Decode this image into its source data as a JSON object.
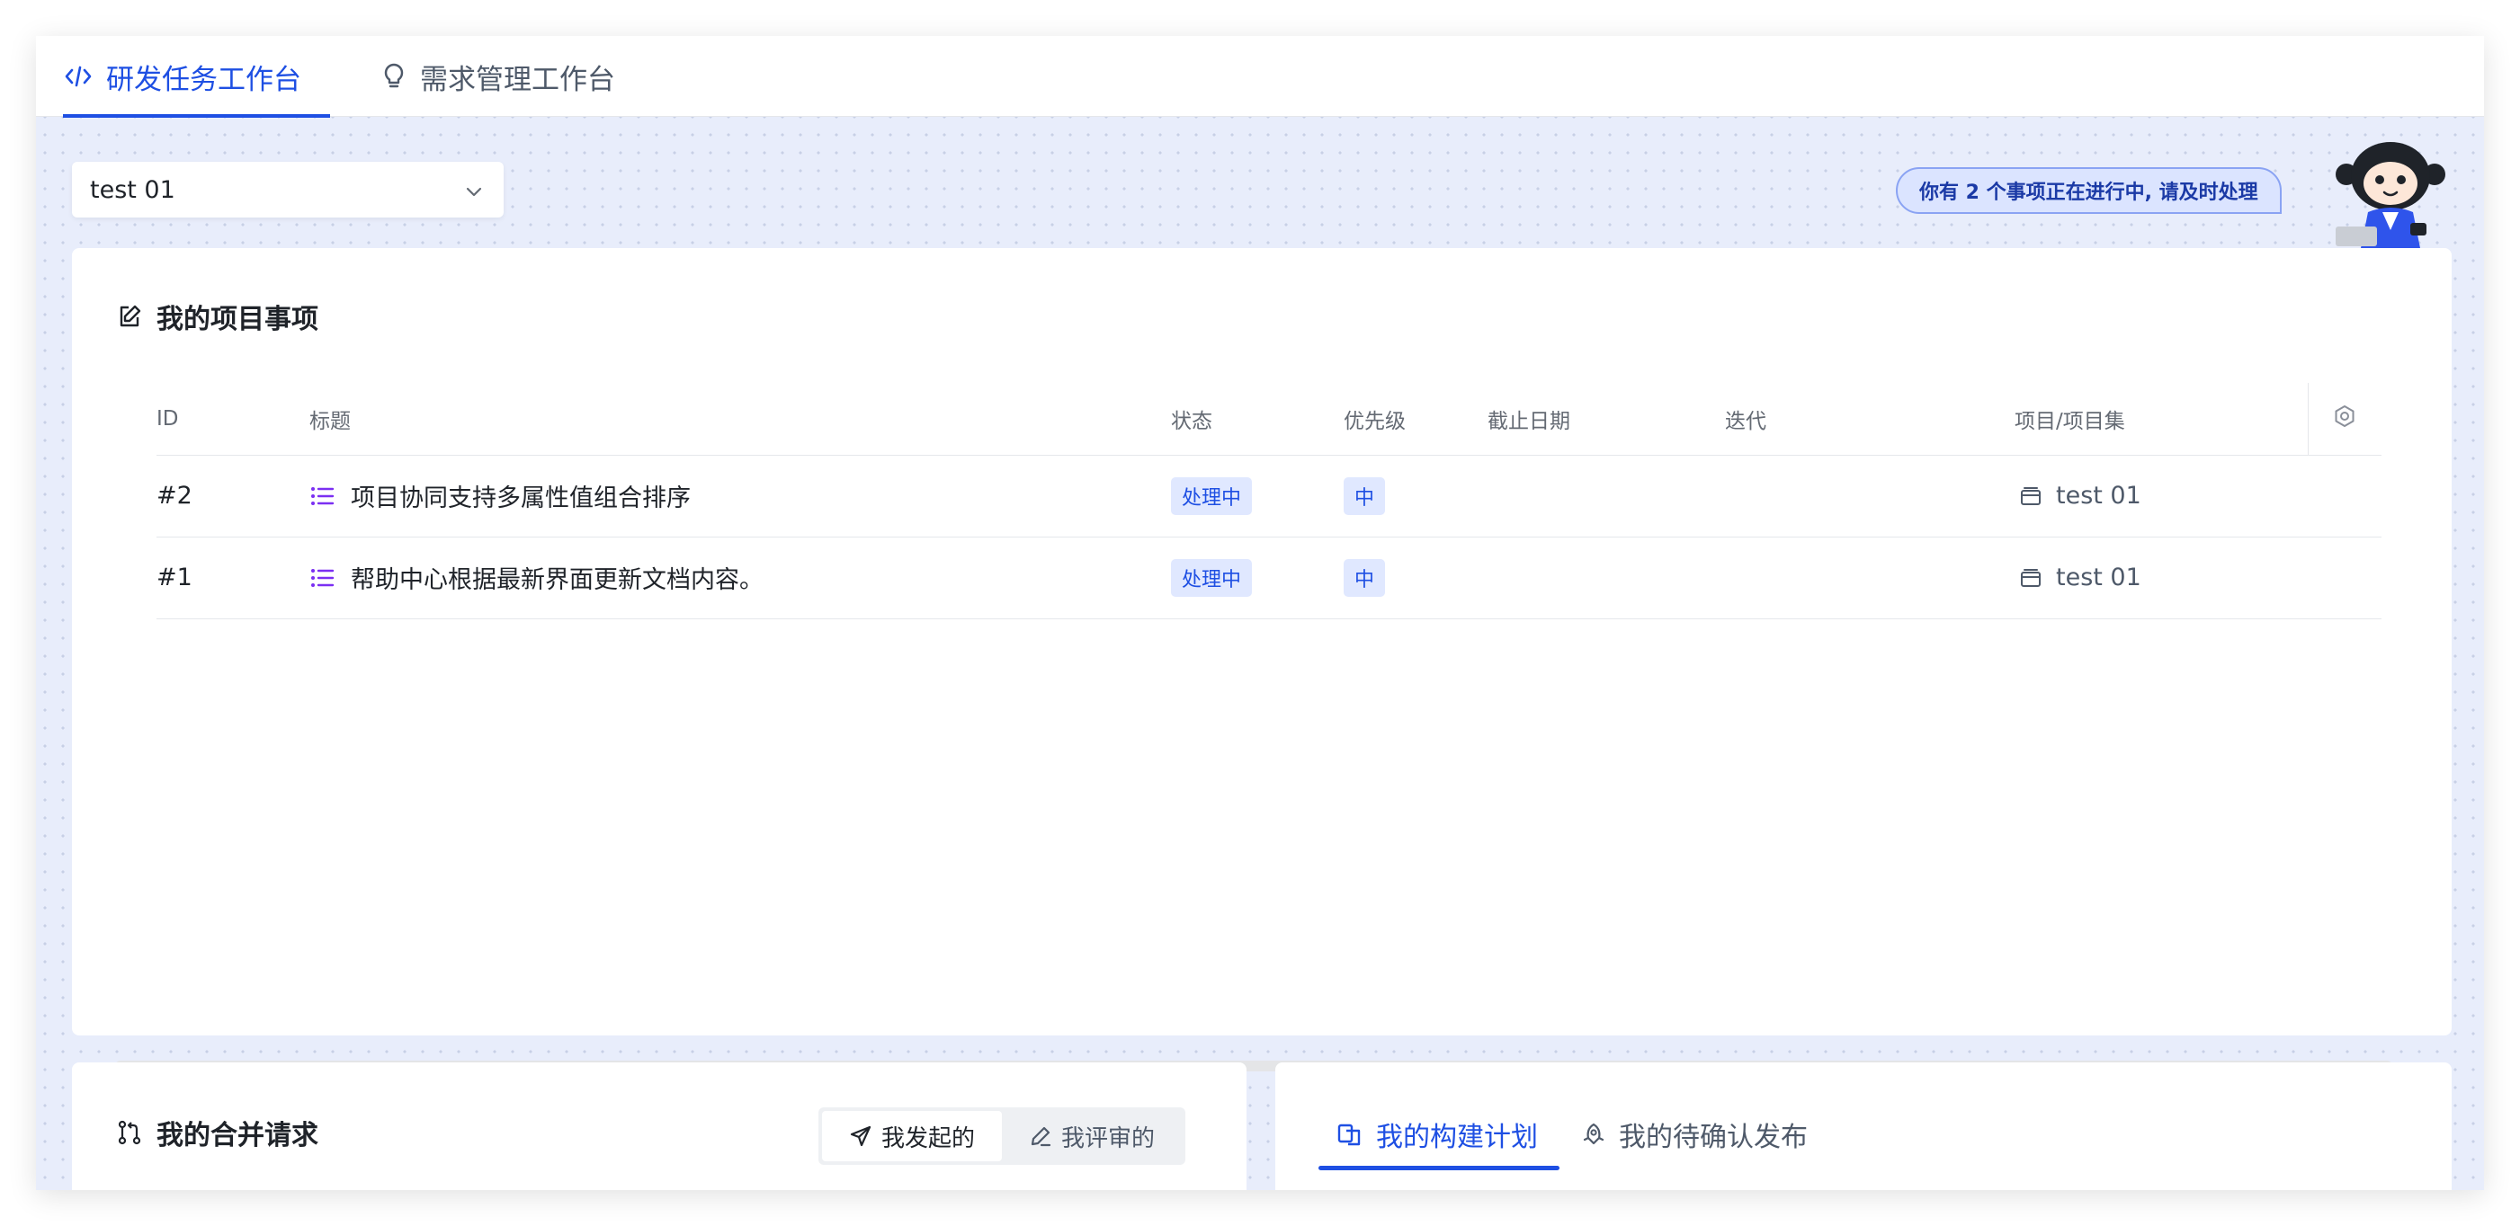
{
  "top_tabs": [
    {
      "label": "研发任务工作台",
      "icon": "code-icon",
      "active": true
    },
    {
      "label": "需求管理工作台",
      "icon": "lightbulb-icon",
      "active": false
    }
  ],
  "project_select": {
    "value": "test 01",
    "icon": "chevron-down-icon"
  },
  "notice": "你有 2 个事项正在进行中, 请及时处理",
  "items_card": {
    "title": "我的项目事项",
    "icon": "edit-note-icon",
    "columns": [
      "ID",
      "标题",
      "状态",
      "优先级",
      "截止日期",
      "迭代",
      "项目/项目集"
    ],
    "rows": [
      {
        "id": "#2",
        "title": "项目协同支持多属性值组合排序",
        "status": "处理中",
        "priority": "中",
        "due": "",
        "iteration": "",
        "project": "test 01"
      },
      {
        "id": "#1",
        "title": "帮助中心根据最新界面更新文档内容。",
        "status": "处理中",
        "priority": "中",
        "due": "",
        "iteration": "",
        "project": "test 01"
      }
    ]
  },
  "mr_card": {
    "title": "我的合并请求",
    "icon": "merge-request-icon",
    "segments": [
      {
        "label": "我发起的",
        "icon": "send-icon",
        "active": true
      },
      {
        "label": "我评审的",
        "icon": "pen-icon",
        "active": false
      }
    ]
  },
  "build_card": {
    "tabs": [
      {
        "label": "我的构建计划",
        "icon": "build-icon",
        "active": true
      },
      {
        "label": "我的待确认发布",
        "icon": "rocket-icon",
        "active": false
      }
    ]
  },
  "colors": {
    "accent": "#1e4fe3",
    "background": "#e8edfb",
    "tag_bg": "#e0e8ff",
    "list_icon": "#7b2ff2"
  }
}
